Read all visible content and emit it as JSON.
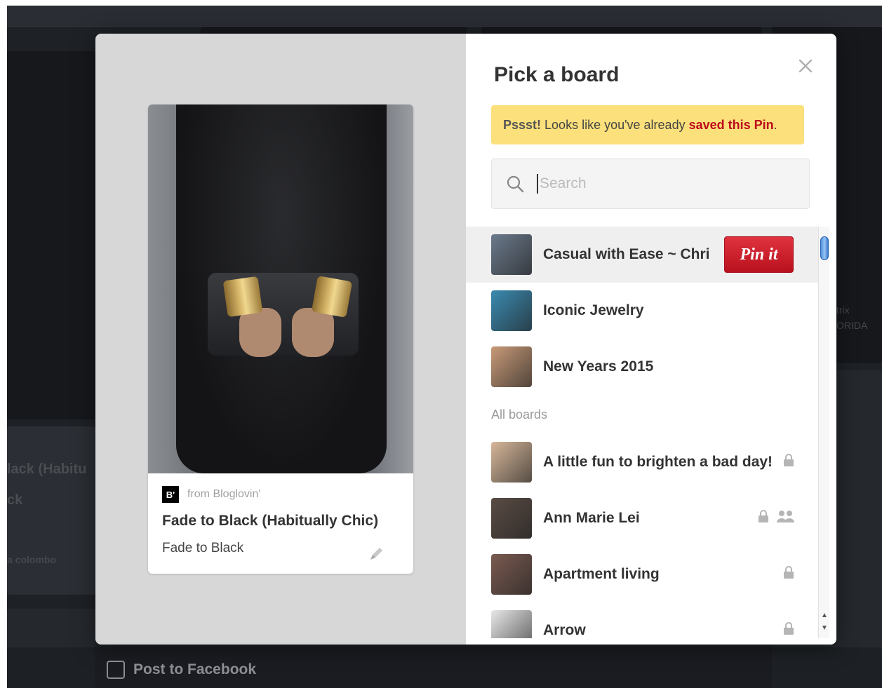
{
  "modal": {
    "title": "Pick a board",
    "notice": {
      "prefix": "Pssst!",
      "middle": " Looks like you've already ",
      "link": "saved this Pin",
      "suffix": "."
    },
    "search": {
      "placeholder": "Search",
      "value": ""
    },
    "pin": {
      "source_logo": "B'",
      "source": "from Bloglovin'",
      "title": "Fade to Black (Habitually Chic)",
      "description": "Fade to Black"
    },
    "pinit_label": "Pin it",
    "top_boards": [
      {
        "name": "Casual with Ease ~ Chri",
        "thumb": "#6b7a8c",
        "hover": true
      },
      {
        "name": "Iconic Jewelry",
        "thumb": "#3a8ab0",
        "hover": false
      },
      {
        "name": "New Years 2015",
        "thumb": "#c89a78",
        "hover": false
      }
    ],
    "section_label": "All boards",
    "all_boards": [
      {
        "name": "A little fun to brighten a bad day!",
        "thumb": "#d7b79a",
        "secret": true,
        "group": false
      },
      {
        "name": "Ann Marie Lei",
        "thumb": "#5a4c44",
        "secret": true,
        "group": true
      },
      {
        "name": "Apartment living",
        "thumb": "#7a5a50",
        "secret": true,
        "group": false
      },
      {
        "name": "Arrow",
        "thumb": "#e8e8e8",
        "secret": true,
        "group": false
      }
    ]
  },
  "facebook": {
    "label": "Post to Facebook",
    "checked": false
  },
  "background": {
    "text_1": "lack (Habitu",
    "text_2": "ck",
    "text_3": "a colombo",
    "text_4": "trix",
    "text_5": "ORIDA"
  },
  "colors": {
    "accent": "#bd081c",
    "notice_bg": "#fbe07b",
    "pinit_bg": "#cb2027"
  },
  "icons": {
    "close": "close-icon",
    "search": "search-icon",
    "edit": "pencil-icon",
    "lock": "lock-icon",
    "group": "group-icon"
  }
}
